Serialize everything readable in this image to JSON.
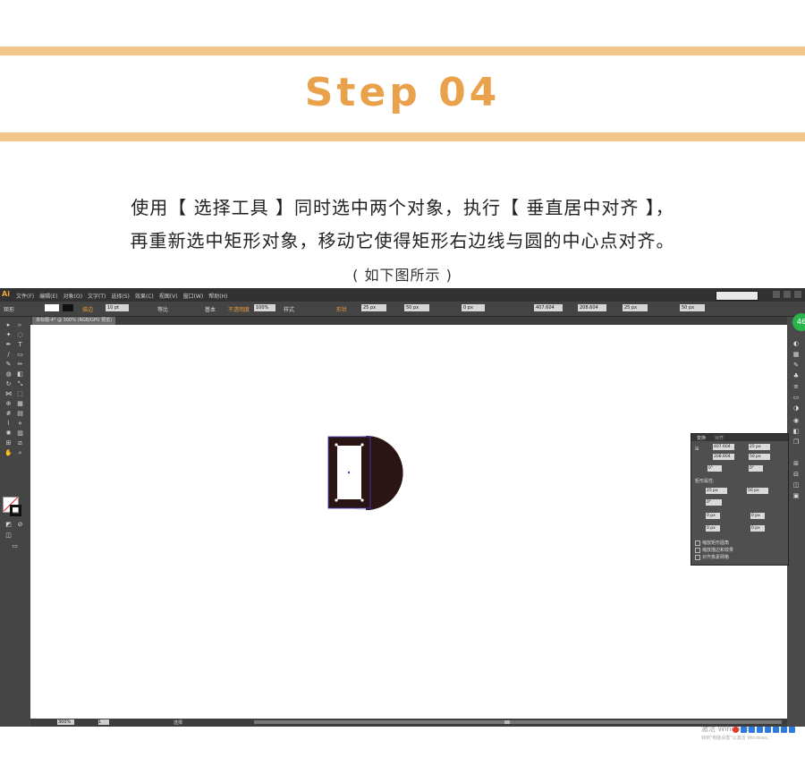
{
  "header": {
    "title": "Step 04",
    "line1": "使用【 选择工具 】同时选中两个对象，执行【 垂直居中对齐 】，",
    "line2": "再重新选中矩形对象，移动它使得矩形右边线与圆的中心点对齐。",
    "line3": "( 如下图所示 )",
    "accent_color": "#eaa14c",
    "bar_color": "#f3c58b"
  },
  "app": {
    "logo": "Ai",
    "menu": [
      "文件(F)",
      "编辑(E)",
      "对象(O)",
      "文字(T)",
      "选择(S)",
      "效果(C)",
      "视图(V)",
      "窗口(W)",
      "帮助(H)"
    ],
    "control": {
      "object_type": "矩形",
      "stroke_label": "描边",
      "stroke_value": "10 pt",
      "profile": "等比",
      "brush": "基本",
      "opacity_label": "不透明度",
      "opacity_value": "100%",
      "style_label": "样式",
      "shape_label": "形状",
      "w_value": "25 px",
      "h_value": "50 px",
      "radius_value": "0 px",
      "x_value": "407.604",
      "y_value": "208.604",
      "w2_value": "25 px",
      "h2_value": "50 px"
    },
    "doc_tab": "未标题-4* @ 300% (RGB/GPU 预览)",
    "status": {
      "zoom": "300%",
      "page": "1",
      "selection": "选择"
    },
    "transform_panel": {
      "tab_transform": "变换",
      "tab_align": "对齐",
      "x": "407.604",
      "y": "208.604",
      "w": "25 px",
      "h": "50 px",
      "angle": "0°",
      "shear": "0°",
      "rect_props": "矩形属性:",
      "rw": "25 px",
      "rh": "50 px",
      "rotation": "0°",
      "r1": "0 px",
      "r2": "0 px",
      "r3": "0 px",
      "r4": "0 px",
      "opt1": "缩放矩形圆角",
      "opt2": "缩放描边和效果",
      "opt3": "对齐像素网格"
    },
    "watermark": "激活 Windows",
    "watermark_sub": "转到\"电脑设置\"以激活 Windows。",
    "badge": "46"
  }
}
